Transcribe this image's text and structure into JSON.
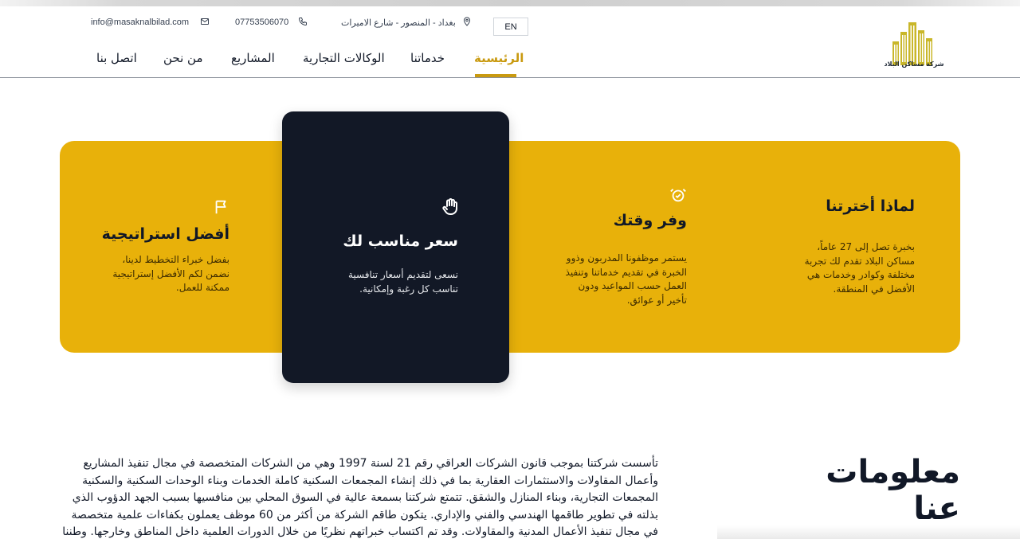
{
  "header": {
    "logo_text": "شركة مساكن البلاد",
    "lang_button": "EN",
    "address": "بغداد - المنصور - شارع الاميرات",
    "phone": "07753506070",
    "email": "info@masaknalbilad.com"
  },
  "nav": {
    "items": [
      {
        "label": "الرئيسية"
      },
      {
        "label": "خدماتنا"
      },
      {
        "label": "الوكالات التجارية"
      },
      {
        "label": "المشاريع"
      },
      {
        "label": "من نحن"
      },
      {
        "label": "اتصل بنا"
      }
    ],
    "active_index": 0
  },
  "features": {
    "why": {
      "title": "لماذا أخترتنا",
      "text": "بخبرة تصل إلى 27 عاماً، مساكن البلاد تقدم لك تجربة مختلفة وكوادر وخدمات هي الأفضل في المنطقة."
    },
    "time": {
      "title": "وفر وقتك",
      "text": "يستمر موظفونا المدربون وذوو الخبرة في تقديم خدماتنا وتنفيذ العمل حسب المواعيد ودون تأخير أو عوائق."
    },
    "price": {
      "title": "سعر مناسب لك",
      "text": "نسعى لتقديم أسعار تنافسية تناسب كل رغبة وإمكانية."
    },
    "strategy": {
      "title": "أفضل استراتيجية",
      "text": "بفضل خبراء التخطيط لدينا، نضمن لكم الأفضل إستراتيجية ممكنة للعمل."
    }
  },
  "about": {
    "title": "معلومات عنا",
    "text": "تأسست شركتنا بموجب قانون الشركات العراقي رقم 21 لسنة 1997 وهي من الشركات المتخصصة في مجال تنفيذ المشاريع وأعمال المقاولات والاستثمارات العقارية بما في ذلك إنشاء المجمعات السكنية كاملة الخدمات وبناء الوحدات السكنية والسكنية المجمعات التجارية، وبناء المنازل والشقق. تتمتع شركتنا بسمعة عالية في السوق المحلي بين منافسيها بسبب الجهد الدؤوب الذي بذلته في تطوير طاقمها الهندسي والفني والإداري. يتكون طاقم الشركة من أكثر من 60 موظف يعملون بكفاءات علمية متخصصة في مجال تنفيذ الأعمال المدنية والمقاولات. وقد تم اكتساب خبراتهم نظريًا من خلال الدورات العلمية داخل المناطق وخارجها. وطننا العزيز وعمليًا من"
  },
  "colors": {
    "accent": "#c99a10",
    "band": "#e8b10a",
    "dark_card": "#121826"
  }
}
